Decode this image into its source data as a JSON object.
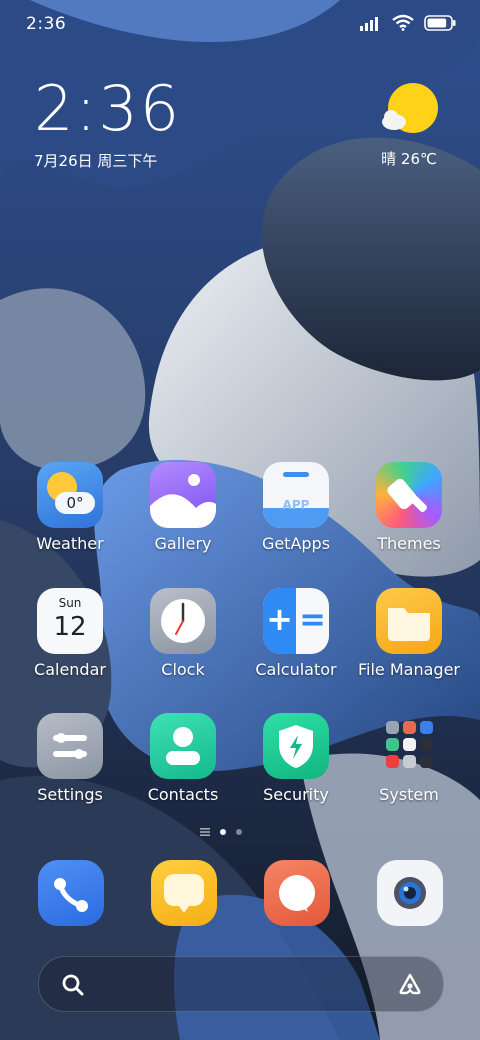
{
  "status_bar": {
    "time": "2:36",
    "battery_level": 0.85
  },
  "clock_widget": {
    "time": "2:36",
    "date": "7月26日 周三下午"
  },
  "weather_widget": {
    "condition_temp": "晴 26℃",
    "icon": "sun-with-cloud-icon"
  },
  "apps": [
    {
      "label": "Weather",
      "icon": "weather-icon",
      "badge": "0°"
    },
    {
      "label": "Gallery",
      "icon": "gallery-icon"
    },
    {
      "label": "GetApps",
      "icon": "getapps-icon",
      "badge": "APP"
    },
    {
      "label": "Themes",
      "icon": "themes-icon"
    },
    {
      "label": "Calendar",
      "icon": "calendar-icon",
      "day_name": "Sun",
      "day_number": "12"
    },
    {
      "label": "Clock",
      "icon": "clock-icon"
    },
    {
      "label": "Calculator",
      "icon": "calculator-icon",
      "glyph_plus": "+",
      "glyph_equals": "="
    },
    {
      "label": "File Manager",
      "icon": "file-manager-icon"
    },
    {
      "label": "Settings",
      "icon": "settings-icon"
    },
    {
      "label": "Contacts",
      "icon": "contacts-icon"
    },
    {
      "label": "Security",
      "icon": "security-icon"
    },
    {
      "label": "System",
      "icon": "system-folder-icon"
    }
  ],
  "dock": [
    {
      "icon": "phone-icon"
    },
    {
      "icon": "messages-icon"
    },
    {
      "icon": "browser-icon"
    },
    {
      "icon": "camera-icon"
    }
  ],
  "page_indicator": {
    "pages": 2,
    "current": 1
  },
  "search_bar": {
    "icon": "search-icon",
    "assistant_icon": "assistant-icon"
  },
  "colors": {
    "wallpaper_blue": "#4a78c9",
    "wallpaper_dark": "#1e2c4a",
    "wallpaper_gray": "#c9d0da",
    "sun": "#ffd21a"
  }
}
